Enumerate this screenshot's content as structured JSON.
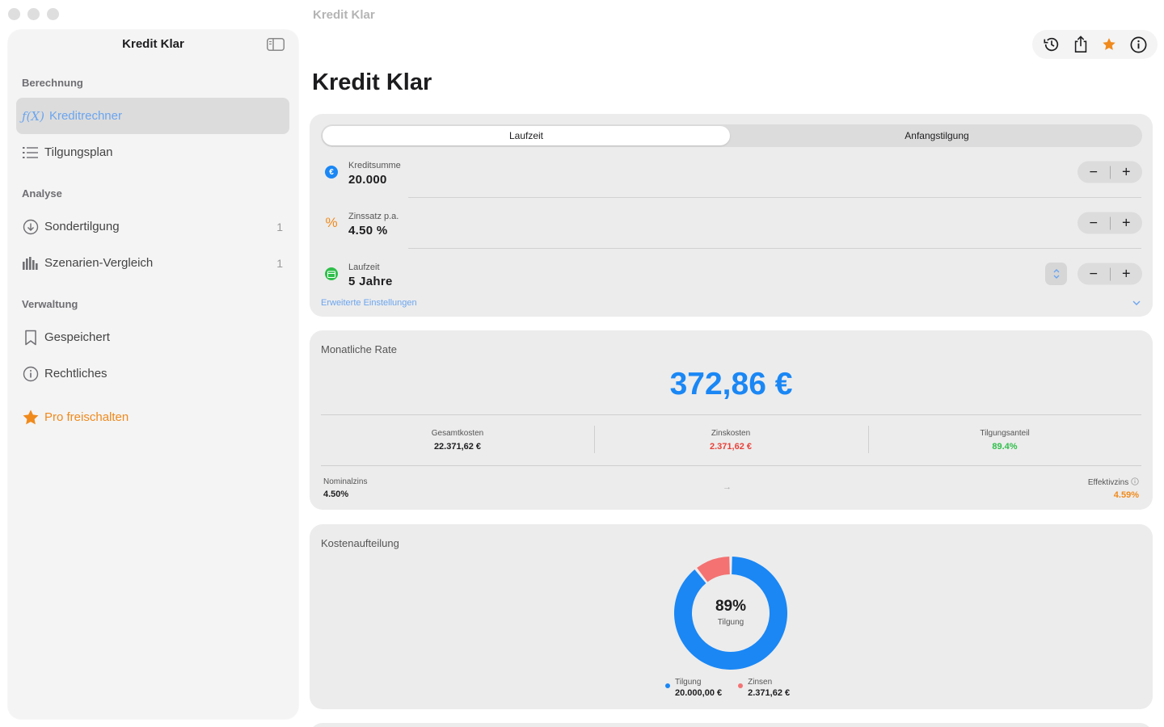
{
  "window": {
    "title": "Kredit Klar"
  },
  "sidebar": {
    "title": "Kredit Klar",
    "sections": [
      {
        "label": "Berechnung"
      },
      {
        "label": "Analyse"
      },
      {
        "label": "Verwaltung"
      }
    ],
    "items": [
      {
        "label": "Kreditrechner",
        "icon": "function-icon",
        "icon_text": "ƒ(X)",
        "active": true
      },
      {
        "label": "Tilgungsplan",
        "icon": "list-icon"
      },
      {
        "label": "Sondertilgung",
        "icon": "arrow-down-circle-icon",
        "count": "1"
      },
      {
        "label": "Szenarien-Vergleich",
        "icon": "bar-chart-icon",
        "count": "1"
      },
      {
        "label": "Gespeichert",
        "icon": "bookmark-icon"
      },
      {
        "label": "Rechtliches",
        "icon": "info-circle-icon"
      },
      {
        "label": "Pro freischalten",
        "icon": "star-icon"
      }
    ]
  },
  "toolbar": {
    "buttons": [
      "history-icon",
      "share-icon",
      "star-icon",
      "info-icon"
    ]
  },
  "main": {
    "title": "Kredit Klar",
    "segmented": {
      "options": [
        "Laufzeit",
        "Anfangstilgung"
      ],
      "selected": "Laufzeit"
    },
    "inputs": [
      {
        "label": "Kreditsumme",
        "value": "20.000",
        "icon": "euro-icon",
        "icon_text": "€",
        "color": "#1a87f5"
      },
      {
        "label": "Zinssatz p.a.",
        "value": "4.50 %",
        "icon": "percent-icon",
        "icon_text": "%",
        "color": "#f08a1c"
      },
      {
        "label": "Laufzeit",
        "value": "5 Jahre",
        "icon": "calendar-icon",
        "icon_text": "",
        "color": "#2fbf4a"
      }
    ],
    "stepper": {
      "minus": "−",
      "plus": "+"
    },
    "advanced_link": "Erweiterte Einstellungen",
    "rate": {
      "label": "Monatliche Rate",
      "value": "372,86 €",
      "stats": [
        {
          "label": "Gesamtkosten",
          "value": "22.371,62 €",
          "color": "#1d1d1f"
        },
        {
          "label": "Zinskosten",
          "value": "2.371,62 €",
          "color": "#e8423a"
        },
        {
          "label": "Tilgungsanteil",
          "value": "89.4%",
          "color": "#2fbf4a"
        }
      ],
      "nominal": {
        "label": "Nominalzins",
        "value": "4.50%"
      },
      "effektiv": {
        "label": "Effektivzins",
        "value": "4.59%",
        "color": "#f08a1c"
      },
      "arrow": "→"
    },
    "breakdown": {
      "label": "Kostenaufteilung",
      "center_value": "89%",
      "center_label": "Tilgung",
      "legend": [
        {
          "label": "Tilgung",
          "value": "20.000,00 €",
          "color": "#1a87f5"
        },
        {
          "label": "Zinsen",
          "value": "2.371,62 €",
          "color": "#f47272"
        }
      ]
    }
  },
  "colors": {
    "accent": "#1a87f5",
    "orange": "#f08a1c",
    "red": "#e8423a",
    "green": "#2fbf4a",
    "pink": "#f47272"
  },
  "chart_data": {
    "type": "pie",
    "categories": [
      "Tilgung",
      "Zinsen"
    ],
    "values": [
      20000.0,
      2371.62
    ],
    "center_label": "89% Tilgung"
  }
}
